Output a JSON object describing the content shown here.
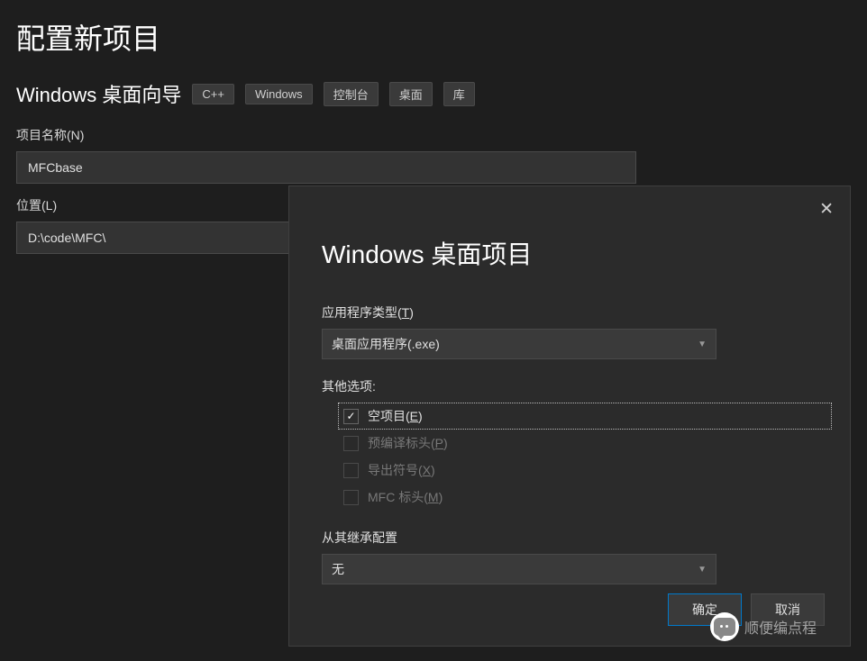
{
  "page": {
    "title": "配置新项目",
    "subtitle": "Windows 桌面向导",
    "tags": [
      "C++",
      "Windows",
      "控制台",
      "桌面",
      "库"
    ]
  },
  "form": {
    "projectName": {
      "label": "项目名称(N)",
      "value": "MFCbase"
    },
    "location": {
      "label": "位置(L)",
      "value": "D:\\code\\MFC\\"
    }
  },
  "modal": {
    "title": "Windows 桌面项目",
    "appType": {
      "label_pre": "应用程序类型(",
      "label_u": "T",
      "label_post": ")",
      "value": "桌面应用程序(.exe)"
    },
    "otherOptions": {
      "label": "其他选项:",
      "items": [
        {
          "label_pre": "空项目(",
          "label_u": "E",
          "label_post": ")",
          "checked": true,
          "disabled": false,
          "focused": true
        },
        {
          "label_pre": "预编译标头(",
          "label_u": "P",
          "label_post": ")",
          "checked": false,
          "disabled": true,
          "focused": false
        },
        {
          "label_pre": "导出符号(",
          "label_u": "X",
          "label_post": ")",
          "checked": false,
          "disabled": true,
          "focused": false
        },
        {
          "label_pre": "MFC 标头(",
          "label_u": "M",
          "label_post": ")",
          "checked": false,
          "disabled": true,
          "focused": false
        }
      ]
    },
    "inherit": {
      "label": "从其继承配置",
      "value": "无"
    },
    "buttons": {
      "ok": "确定",
      "cancel": "取消"
    }
  },
  "watermark": {
    "text": "顺便编点程"
  }
}
